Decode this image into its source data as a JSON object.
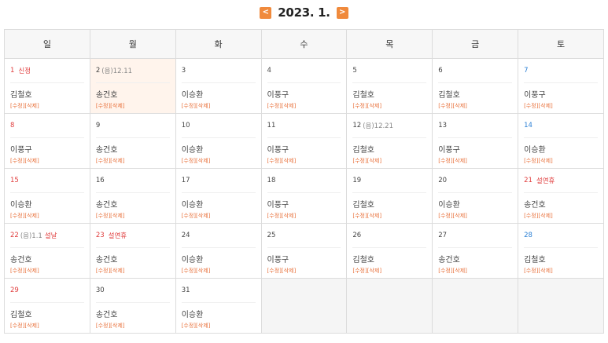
{
  "header": {
    "prev_label": "<",
    "next_label": ">",
    "title": "2023. 1."
  },
  "weekdays": [
    "일",
    "월",
    "화",
    "수",
    "목",
    "금",
    "토"
  ],
  "event_actions": "[수정][삭제]",
  "weeks": [
    [
      {
        "num": "1",
        "label": "신정",
        "holiday": true,
        "name": "김철호"
      },
      {
        "num": "2",
        "lunar": "(음)12.11",
        "today": true,
        "name": "송건호"
      },
      {
        "num": "3",
        "name": "이승환"
      },
      {
        "num": "4",
        "name": "이풍구"
      },
      {
        "num": "5",
        "name": "김철호"
      },
      {
        "num": "6",
        "name": "김철호"
      },
      {
        "num": "7",
        "sat": true,
        "name": "이풍구"
      }
    ],
    [
      {
        "num": "8",
        "sun": true,
        "name": "이풍구"
      },
      {
        "num": "9",
        "name": "송건호"
      },
      {
        "num": "10",
        "name": "이승환"
      },
      {
        "num": "11",
        "name": "이풍구"
      },
      {
        "num": "12",
        "lunar": "(음)12.21",
        "name": "김철호"
      },
      {
        "num": "13",
        "name": "이풍구"
      },
      {
        "num": "14",
        "sat": true,
        "name": "이승환"
      }
    ],
    [
      {
        "num": "15",
        "sun": true,
        "name": "이승환"
      },
      {
        "num": "16",
        "name": "송건호"
      },
      {
        "num": "17",
        "name": "이승환"
      },
      {
        "num": "18",
        "name": "이풍구"
      },
      {
        "num": "19",
        "name": "김철호"
      },
      {
        "num": "20",
        "name": "이승환"
      },
      {
        "num": "21",
        "label": "설연휴",
        "holiday": true,
        "name": "송건호"
      }
    ],
    [
      {
        "num": "22",
        "lunar": "(음)1.1",
        "label": "설날",
        "holiday": true,
        "name": "송건호"
      },
      {
        "num": "23",
        "label": "설연휴",
        "holiday": true,
        "name": "송건호"
      },
      {
        "num": "24",
        "name": "이승환"
      },
      {
        "num": "25",
        "name": "이풍구"
      },
      {
        "num": "26",
        "name": "김철호"
      },
      {
        "num": "27",
        "name": "송건호"
      },
      {
        "num": "28",
        "sat": true,
        "name": "김철호"
      }
    ],
    [
      {
        "num": "29",
        "sun": true,
        "name": "김철호"
      },
      {
        "num": "30",
        "name": "송건호"
      },
      {
        "num": "31",
        "name": "이승환"
      },
      null,
      null,
      null,
      null
    ]
  ]
}
